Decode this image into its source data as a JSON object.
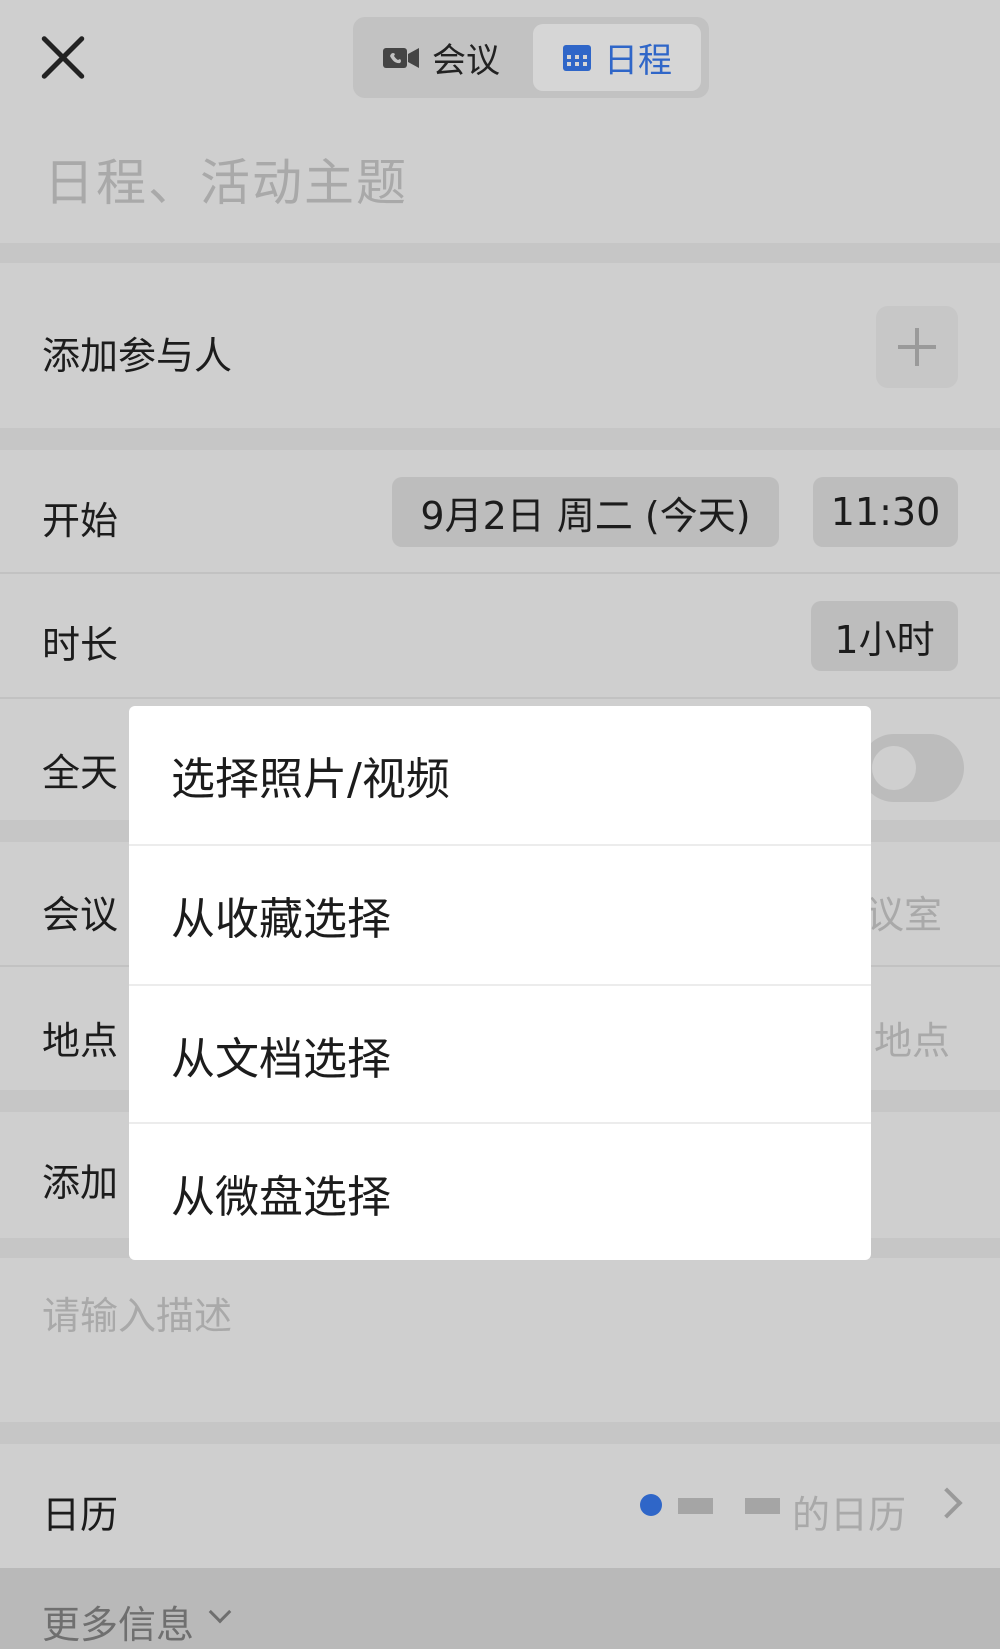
{
  "header": {
    "tabs": [
      {
        "label": "会议",
        "icon": "video-camera-icon",
        "selected": false
      },
      {
        "label": "日程",
        "icon": "calendar-icon",
        "selected": true
      }
    ],
    "close_icon": "close-icon"
  },
  "title_placeholder": "日程、活动主题",
  "participants": {
    "label": "添加参与人",
    "add_icon": "plus-icon"
  },
  "start": {
    "label": "开始",
    "date": "9月2日 周二 (今天)",
    "time": "11:30"
  },
  "duration": {
    "label": "时长",
    "value": "1小时"
  },
  "all_day": {
    "label": "全天",
    "enabled": false
  },
  "meeting_room": {
    "label": "会议",
    "placeholder": "议室"
  },
  "location": {
    "label": "地点",
    "placeholder": "地点"
  },
  "attachment": {
    "label": "添加"
  },
  "description": {
    "placeholder": "请输入描述"
  },
  "calendar": {
    "label": "日历",
    "value": "的日历",
    "dot_color": "#2f66c8"
  },
  "more_info": {
    "label": "更多信息"
  },
  "popup_menu": {
    "items": [
      "选择照片/视频",
      "从收藏选择",
      "从文档选择",
      "从微盘选择"
    ]
  }
}
